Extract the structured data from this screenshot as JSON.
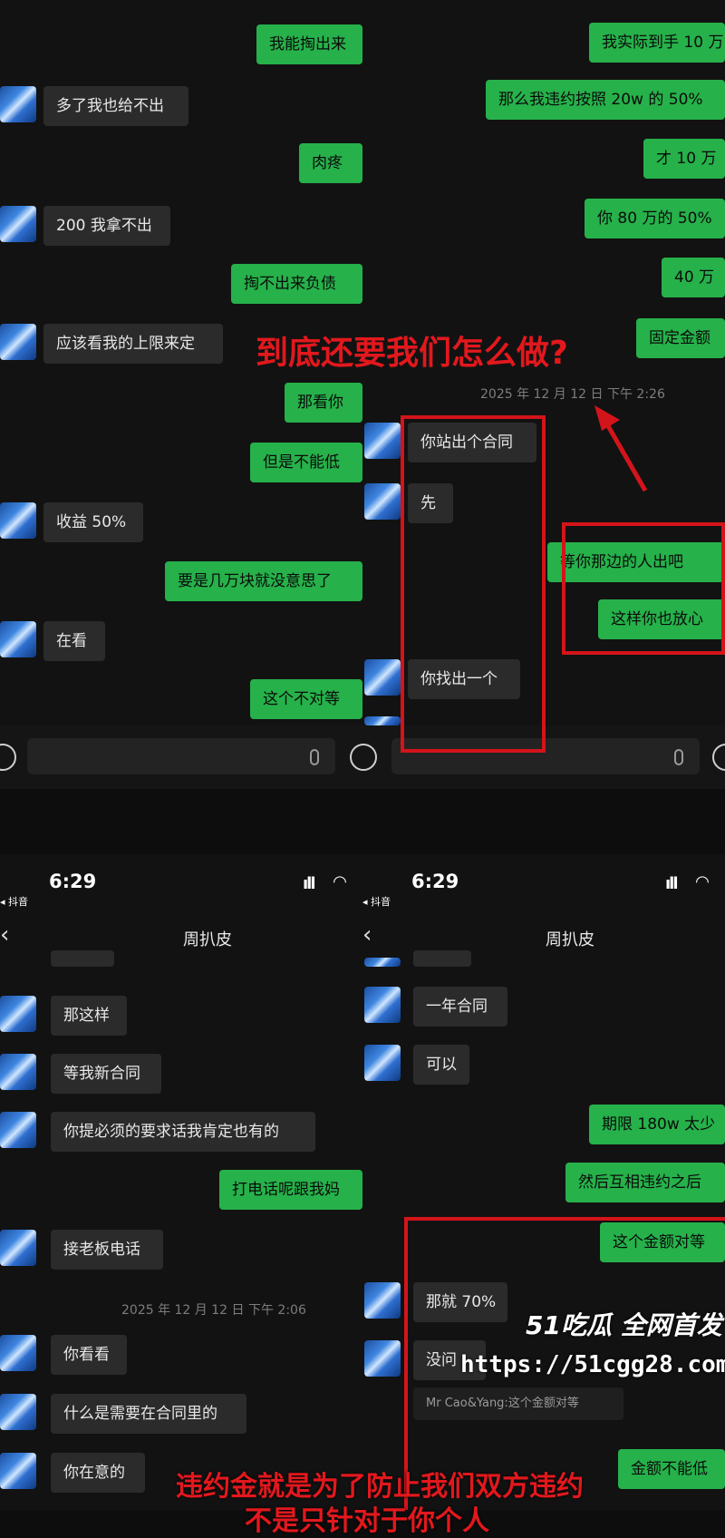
{
  "top_left": {
    "messages": [
      {
        "side": "out",
        "text": "我能掏出来"
      },
      {
        "side": "in",
        "text": "多了我也给不出"
      },
      {
        "side": "out",
        "text": "肉疼"
      },
      {
        "side": "in",
        "text": "200 我拿不出"
      },
      {
        "side": "out",
        "text": "掏不出来负债"
      },
      {
        "side": "in",
        "text": "应该看我的上限来定"
      },
      {
        "side": "out",
        "text": "那看你"
      },
      {
        "side": "out",
        "text": "但是不能低"
      },
      {
        "side": "in",
        "text": "收益 50%"
      },
      {
        "side": "out",
        "text": "要是几万块就没意思了"
      },
      {
        "side": "in",
        "text": "在看"
      },
      {
        "side": "out",
        "text": "这个不对等"
      }
    ]
  },
  "top_right": {
    "messages": [
      {
        "side": "out",
        "text": "我实际到手 10 万"
      },
      {
        "side": "out",
        "text": "那么我违约按照 20w 的 50%"
      },
      {
        "side": "out",
        "text": "才 10 万"
      },
      {
        "side": "out",
        "text": "你 80 万的 50%"
      },
      {
        "side": "out",
        "text": "40 万"
      },
      {
        "side": "out",
        "text": "固定金额"
      },
      {
        "side": "in",
        "text": "你站出个合同"
      },
      {
        "side": "in",
        "text": "先"
      },
      {
        "side": "out",
        "text": "等你那边的人出吧"
      },
      {
        "side": "out",
        "text": "这样你也放心"
      },
      {
        "side": "in",
        "text": "你找出一个"
      }
    ],
    "timestamp": "2025 年 12 月 12 日 下午 2:26"
  },
  "annotation": {
    "headline": "到底还要我们怎么做?"
  },
  "bottom_left": {
    "status": {
      "time": "6:29",
      "app": "◂ 抖音"
    },
    "title": "周扒皮",
    "back": "‹",
    "messages": [
      {
        "side": "in",
        "text": "那这样"
      },
      {
        "side": "in",
        "text": "等我新合同"
      },
      {
        "side": "in",
        "text": "你提必须的要求话我肯定也有的"
      },
      {
        "side": "out",
        "text": "打电话呢跟我妈"
      },
      {
        "side": "in",
        "text": "接老板电话"
      },
      {
        "side": "in",
        "text": "你看看"
      },
      {
        "side": "in",
        "text": "什么是需要在合同里的"
      },
      {
        "side": "in",
        "text": "你在意的"
      }
    ],
    "timestamp": "2025 年 12 月 12 日 下午 2:06"
  },
  "bottom_right": {
    "status": {
      "time": "6:29",
      "app": "◂ 抖音"
    },
    "title": "周扒皮",
    "back": "‹",
    "messages": [
      {
        "side": "in",
        "text": "一年合同"
      },
      {
        "side": "in",
        "text": "可以"
      },
      {
        "side": "out",
        "text": "期限 180w 太少"
      },
      {
        "side": "out",
        "text": "然后互相违约之后"
      },
      {
        "side": "out",
        "text": "这个金额对等"
      },
      {
        "side": "in",
        "text": "那就 70%"
      },
      {
        "side": "in",
        "text": "没问"
      },
      {
        "side": "out",
        "text": "金额不能低"
      }
    ],
    "quote": "Mr Cao&Yang:这个金额对等"
  },
  "caption": {
    "line1": "违约金就是为了防止我们双方违约",
    "line2": "不是只针对于你个人"
  },
  "watermark": {
    "brand": "51吃瓜 全网首发",
    "url": "https://51cgg28.com"
  },
  "colors": {
    "out_bubble": "#26b14a",
    "in_bubble": "#2b2b2b",
    "annotation_red": "#d3141a"
  }
}
